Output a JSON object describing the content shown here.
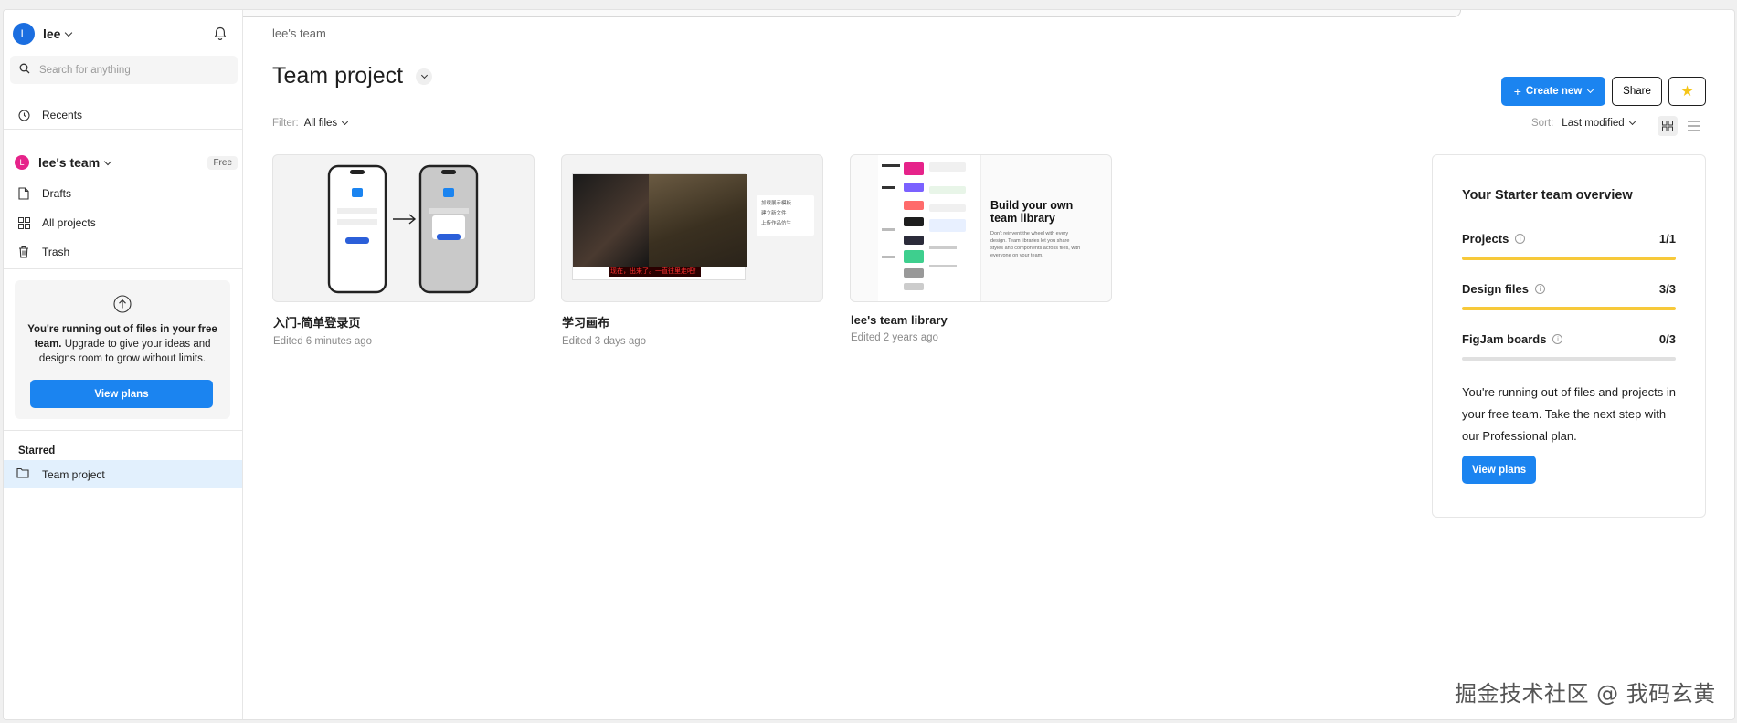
{
  "sidebar": {
    "user": {
      "initial": "L",
      "name": "lee"
    },
    "search": {
      "placeholder": "Search for anything"
    },
    "recents_label": "Recents",
    "team": {
      "initial": "L",
      "name": "lee's team",
      "badge": "Free"
    },
    "nav": {
      "drafts": "Drafts",
      "all_projects": "All projects",
      "trash": "Trash"
    },
    "upgrade": {
      "bold": "You're running out of files in your free team.",
      "rest": " Upgrade to give your ideas and designs room to grow without limits.",
      "button": "View plans"
    },
    "starred": {
      "label": "Starred",
      "items": [
        {
          "label": "Team project"
        }
      ]
    }
  },
  "main": {
    "breadcrumb": "lee's team",
    "title": "Team project",
    "create_label": "Create new",
    "share_label": "Share",
    "star_glyph": "★",
    "filter": {
      "label": "Filter:",
      "value": "All files"
    },
    "sort": {
      "label": "Sort:",
      "value": "Last modified"
    },
    "files": [
      {
        "title": "入门-简单登录页",
        "edited": "Edited 6 minutes ago"
      },
      {
        "title": "学习画布",
        "edited": "Edited 3 days ago",
        "subtitle_text": "现在，出来了。一直往里走吧！",
        "menu": [
          "加载展示模板",
          "建立新文件",
          "上传作品仿生"
        ]
      },
      {
        "title": "lee's team library",
        "edited": "Edited 2 years ago",
        "thumb_heading": "Build your own team library",
        "thumb_body": "Don't reinvent the wheel with every design. Team libraries let you share styles and components across files, with everyone on your team."
      }
    ]
  },
  "overview": {
    "title": "Your Starter team overview",
    "rows": [
      {
        "label": "Projects",
        "count": "1/1",
        "fill": 1.0
      },
      {
        "label": "Design files",
        "count": "3/3",
        "fill": 1.0
      },
      {
        "label": "FigJam boards",
        "count": "0/3",
        "fill": 0.0
      }
    ],
    "text": "You're running out of files and projects in your free team. Take the next step with our Professional plan.",
    "button": "View plans"
  },
  "watermark": "掘金技术社区 @ 我码玄黄",
  "colors": {
    "accent": "#1b84f0",
    "progress": "#f7c93a",
    "selected": "#e2f0fd",
    "team_avatar": "#e6238a"
  }
}
